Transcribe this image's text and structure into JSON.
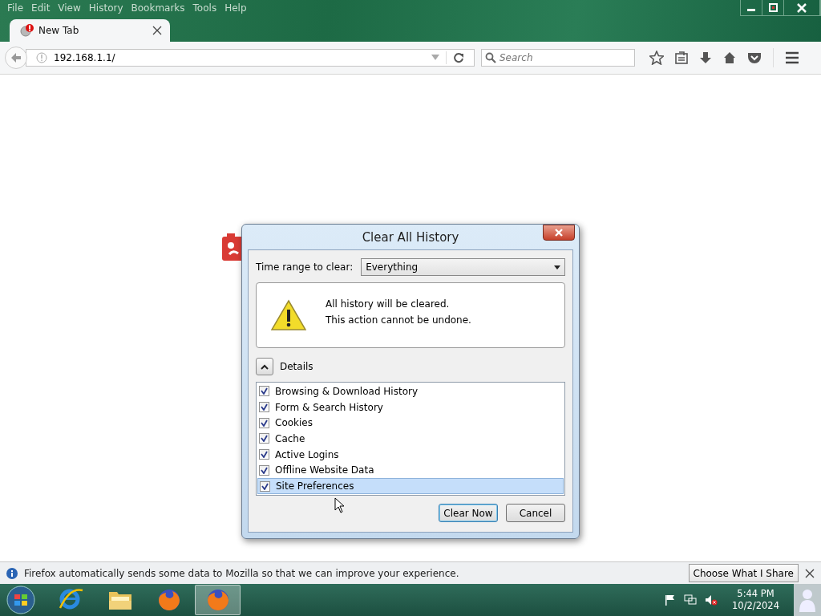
{
  "menu": [
    {
      "label": "File"
    },
    {
      "label": "Edit"
    },
    {
      "label": "View"
    },
    {
      "label": "History"
    },
    {
      "label": "Bookmarks"
    },
    {
      "label": "Tools"
    },
    {
      "label": "Help"
    }
  ],
  "tab": {
    "title": "New Tab",
    "selected": true,
    "alert": true
  },
  "address": {
    "value": "192.168.1.1/"
  },
  "search": {
    "placeholder": "Search"
  },
  "dialog": {
    "title": "Clear All History",
    "time_range_label": "Time range to clear:",
    "time_range_value": "Everything",
    "warning": [
      "All history will be cleared.",
      "This action cannot be undone."
    ],
    "details_label": "Details",
    "details_expanded": true,
    "items": [
      {
        "label": "Browsing & Download History",
        "checked": true,
        "selected": false
      },
      {
        "label": "Form & Search History",
        "checked": true,
        "selected": false
      },
      {
        "label": "Cookies",
        "checked": true,
        "selected": false
      },
      {
        "label": "Cache",
        "checked": true,
        "selected": false
      },
      {
        "label": "Active Logins",
        "checked": true,
        "selected": false
      },
      {
        "label": "Offline Website Data",
        "checked": true,
        "selected": false
      },
      {
        "label": "Site Preferences",
        "checked": true,
        "selected": true
      }
    ],
    "buttons": [
      {
        "label": "Clear Now",
        "default": true
      },
      {
        "label": "Cancel",
        "default": false
      }
    ]
  },
  "notification": {
    "message": "Firefox automatically sends some data to Mozilla so that we can improve your experience.",
    "button": "Choose What I Share"
  },
  "taskbar": {
    "apps": [
      {
        "kind": "browser-e",
        "selected": false
      },
      {
        "kind": "folder",
        "selected": false
      },
      {
        "kind": "fox",
        "selected": false
      },
      {
        "kind": "fox",
        "selected": true
      }
    ],
    "time": "5:44 PM",
    "date": "10/2/2024"
  }
}
